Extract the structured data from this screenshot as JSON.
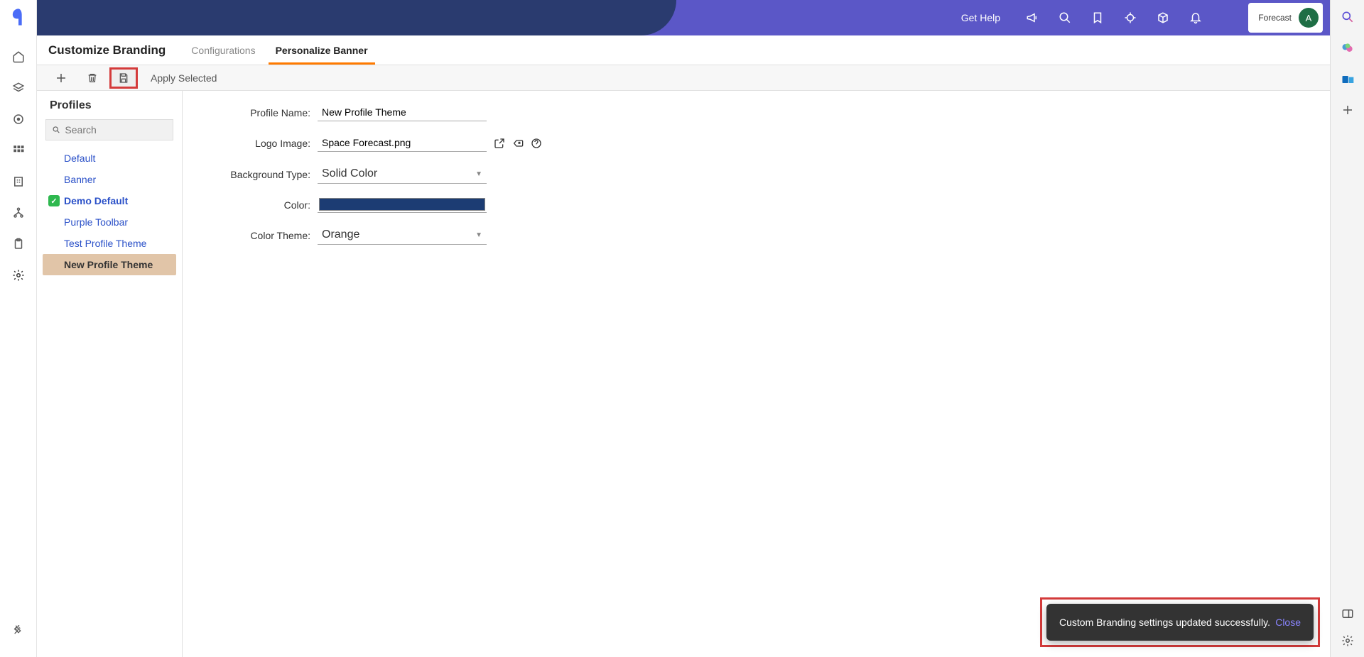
{
  "banner": {
    "get_help": "Get Help",
    "user_name": "Forecast",
    "avatar_letter": "A"
  },
  "page": {
    "title": "Customize Branding",
    "tabs": [
      "Configurations",
      "Personalize Banner"
    ],
    "active_tab_index": 1
  },
  "toolbar": {
    "apply_selected": "Apply Selected"
  },
  "profiles": {
    "heading": "Profiles",
    "search_placeholder": "Search",
    "items": [
      {
        "label": "Default",
        "checked": false,
        "selected": false
      },
      {
        "label": "Banner",
        "checked": false,
        "selected": false
      },
      {
        "label": "Demo Default",
        "checked": true,
        "selected": false
      },
      {
        "label": "Purple Toolbar",
        "checked": false,
        "selected": false
      },
      {
        "label": "Test Profile Theme",
        "checked": false,
        "selected": false
      },
      {
        "label": "New Profile Theme",
        "checked": false,
        "selected": true
      }
    ]
  },
  "form": {
    "profile_name_label": "Profile Name:",
    "profile_name_value": "New Profile Theme",
    "logo_image_label": "Logo Image:",
    "logo_image_value": "Space Forecast.png",
    "background_type_label": "Background Type:",
    "background_type_value": "Solid Color",
    "color_label": "Color:",
    "color_value": "#1c3c73",
    "color_theme_label": "Color Theme:",
    "color_theme_value": "Orange"
  },
  "toast": {
    "message": "Custom Branding settings updated successfully.",
    "close": "Close"
  }
}
